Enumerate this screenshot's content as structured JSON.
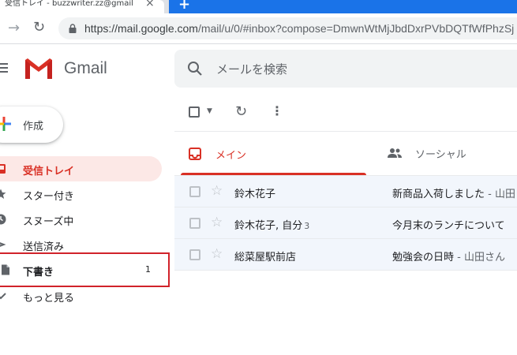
{
  "browser": {
    "tab_title": "受信トレイ - buzzwriter.zz@gmail",
    "url_host": "https://mail.google.com",
    "url_path": "/mail/u/0/#inbox?compose=DmwnWtMjJbdDxrPVbDQTfWfPhzSj"
  },
  "gmail": {
    "logo_text": "Gmail",
    "search_placeholder": "メールを検索"
  },
  "sidebar": {
    "compose_label": "作成",
    "items": [
      {
        "label": "受信トレイ",
        "count": "",
        "icon": "inbox-icon"
      },
      {
        "label": "スター付き",
        "count": "",
        "icon": "star-icon"
      },
      {
        "label": "スヌーズ中",
        "count": "",
        "icon": "clock-icon"
      },
      {
        "label": "送信済み",
        "count": "",
        "icon": "send-icon"
      },
      {
        "label": "下書き",
        "count": "1",
        "icon": "draft-icon"
      },
      {
        "label": "もっと見る",
        "count": "",
        "icon": "chevron-down-icon"
      }
    ]
  },
  "tabs": {
    "primary": "メイン",
    "social": "ソーシャル"
  },
  "emails": [
    {
      "sender": "鈴木花子",
      "count": "",
      "subject": "新商品入荷しました",
      "snippet": " - 山田"
    },
    {
      "sender": "鈴木花子, 自分",
      "count": "3",
      "subject": "今月末のランチについて",
      "snippet": ""
    },
    {
      "sender": "総菜屋駅前店",
      "count": "",
      "subject": "勉強会の日時",
      "snippet": " - 山田さん"
    }
  ],
  "colors": {
    "accent_red": "#d93025",
    "highlight_box": "#d1232a",
    "tab_strip_blue": "#1a73e8"
  }
}
